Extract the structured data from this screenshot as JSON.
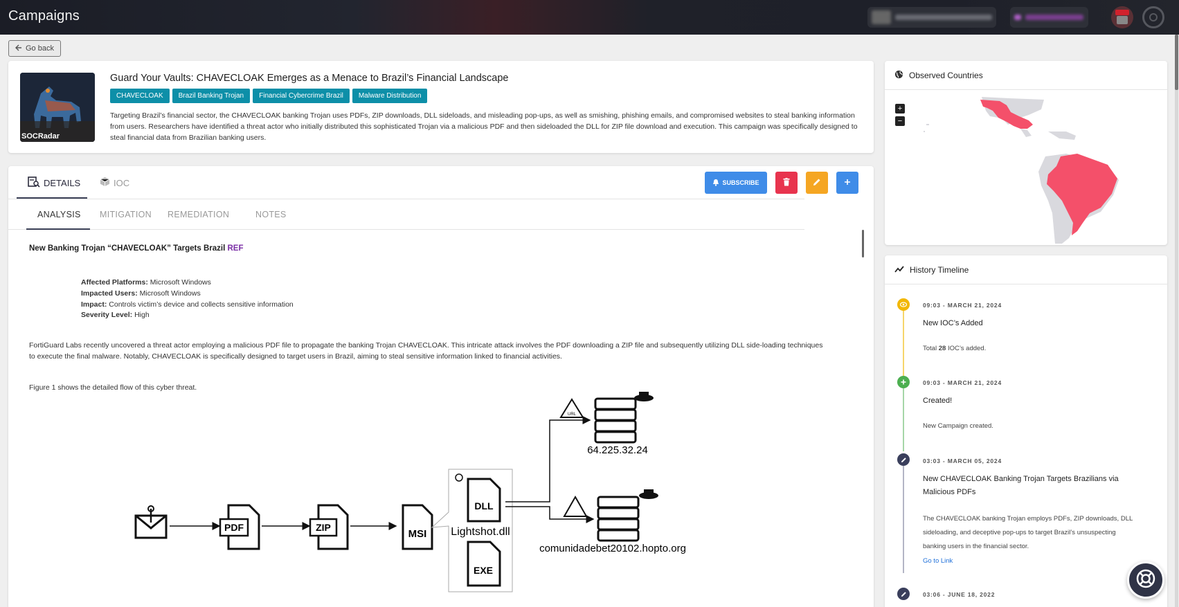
{
  "app": {
    "title": "Campaigns"
  },
  "nav": {
    "go_back": "Go back"
  },
  "campaign": {
    "thumbnail_brand": "SOCRadar",
    "title": "Guard Your Vaults: CHAVECLOAK Emerges as a Menace to Brazil’s Financial Landscape",
    "tags": [
      "CHAVECLOAK",
      "Brazil Banking Trojan",
      "Financial Cybercrime Brazil",
      "Malware Distribution"
    ],
    "description": "Targeting Brazil’s financial sector, the CHAVECLOAK banking Trojan uses PDFs, ZIP downloads, DLL sideloads, and misleading pop-ups, as well as smishing, phishing emails, and compromised websites to steal banking information from users. Researchers have identified a threat actor who initially distributed this sophisticated Trojan via a malicious PDF and then sideloaded the DLL for ZIP file download and execution. This campaign was specifically designed to steal financial data from Brazilian banking users."
  },
  "tabs": {
    "details": "DETAILS",
    "ioc": "IOC"
  },
  "actions": {
    "subscribe": "SUBSCRIBE"
  },
  "subtabs": {
    "analysis": "ANALYSIS",
    "mitigation": "MITIGATION",
    "remediation": "REMEDIATION",
    "notes": "NOTES"
  },
  "analysis": {
    "heading": "New Banking Trojan “CHAVECLOAK” Targets Brazil",
    "ref": "REF",
    "facts": [
      {
        "label": "Affected Platforms:",
        "value": "Microsoft Windows"
      },
      {
        "label": "Impacted Users:",
        "value": "Microsoft Windows"
      },
      {
        "label": "Impact:",
        "value": "Controls victim’s device and collects sensitive information"
      },
      {
        "label": "Severity Level:",
        "value": "High"
      }
    ],
    "paragraph1": "FortiGuard Labs recently uncovered a threat actor employing a malicious PDF file to propagate the banking Trojan CHAVECLOAK. This intricate attack involves the PDF downloading a ZIP file and subsequently utilizing DLL side-loading techniques to execute the final malware. Notably, CHAVECLOAK is specifically designed to target users in Brazil, aiming to steal sensitive information linked to financial activities.",
    "paragraph2": "Figure 1 shows the detailed flow of this cyber threat.",
    "diagram": {
      "pdf": "PDF",
      "zip": "ZIP",
      "msi": "MSI",
      "dll": "DLL",
      "exe": "EXE",
      "dll_name": "Lightshot.dll",
      "ip": "64.225.32.24",
      "domain": "comunidadebet20102.hopto.org",
      "url_badge": "URL"
    }
  },
  "countries": {
    "title": "Observed Countries",
    "zoom_in": "+",
    "zoom_out": "−",
    "highlight_color": "#f4506a",
    "base_color": "#d9d9de"
  },
  "timeline": {
    "title": "History Timeline",
    "items": [
      {
        "date": "09:03 - MARCH 21, 2024",
        "title": "New IOC’s Added",
        "desc_pre": "Total",
        "desc_num": "28",
        "desc_post": "IOC’s added.",
        "color": "#f2b705",
        "icon": "eye-icon"
      },
      {
        "date": "09:03 - MARCH 21, 2024",
        "title": "Created!",
        "desc": "New Campaign created.",
        "color": "#4caf50",
        "icon": "plus-icon"
      },
      {
        "date": "03:03 - MARCH 05, 2024",
        "title": "New CHAVECLOAK Banking Trojan Targets Brazilians via Malicious PDFs",
        "desc": "The CHAVECLOAK banking Trojan employs PDFs, ZIP downloads, DLL sideloading, and deceptive pop-ups to target Brazil’s unsuspecting banking users in the financial sector.",
        "link": "Go to Link",
        "color": "#3a3f5c",
        "icon": "pencil-icon"
      },
      {
        "date": "03:06 - JUNE 18, 2022",
        "color": "#3a3f5c",
        "icon": "pencil-icon"
      }
    ]
  }
}
